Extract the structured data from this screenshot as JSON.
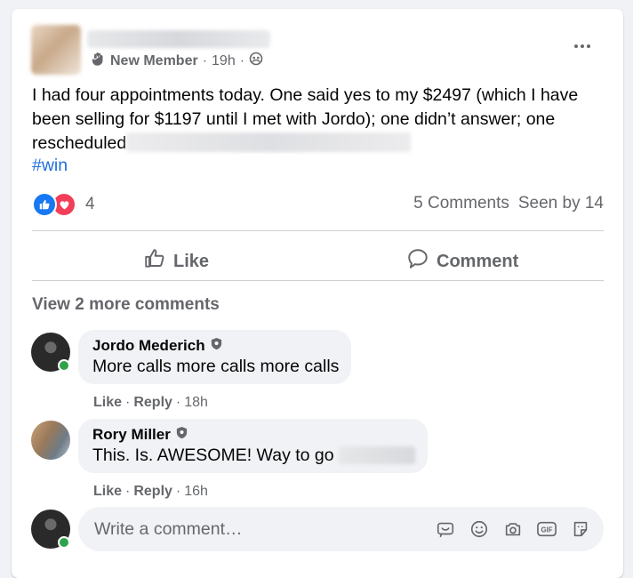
{
  "post": {
    "author_member_role": "New Member",
    "time": "19h",
    "text_part1": "I had four appointments today. One said yes to my $2497 (which I have been selling for $1197 until I met with Jordo); one didn’t answer; one rescheduled",
    "hashtag": "#win",
    "reaction_count": "4",
    "comments_count": "5 Comments",
    "seen_by": "Seen by 14"
  },
  "actions": {
    "like": "Like",
    "comment": "Comment"
  },
  "comments_section": {
    "view_more": "View 2 more comments",
    "comments": [
      {
        "name": "Jordo Mederich",
        "text": "More calls more calls more calls",
        "like": "Like",
        "reply": "Reply",
        "time": "18h"
      },
      {
        "name": "Rory Miller",
        "text": "This. Is. AWESOME! Way to go",
        "like": "Like",
        "reply": "Reply",
        "time": "16h"
      }
    ]
  },
  "composer": {
    "placeholder": "Write a comment…",
    "icons": [
      "sticker-face-icon",
      "emoji-icon",
      "camera-icon",
      "gif-icon",
      "sticker-icon"
    ],
    "gif_label": "GIF"
  },
  "colors": {
    "link": "#216fdb",
    "like_blue": "#1877f2",
    "love_red": "#f33e58",
    "online_green": "#31a24c",
    "secondary_text": "#65676b"
  }
}
